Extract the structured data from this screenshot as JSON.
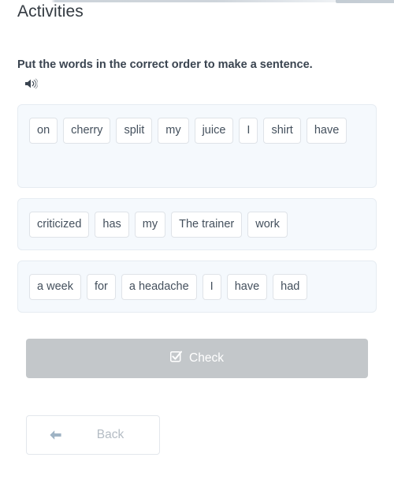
{
  "header": {
    "title": "Activities"
  },
  "instruction": {
    "text": "Put the words in the correct order to make a sentence.",
    "audio_icon": "speaker-icon"
  },
  "exercises": [
    {
      "id": "sentence-1",
      "words": [
        "on",
        "cherry",
        "split",
        "my",
        "juice",
        "I",
        "shirt",
        "have"
      ]
    },
    {
      "id": "sentence-2",
      "words": [
        "criticized",
        "has",
        "my",
        "The trainer",
        "work"
      ]
    },
    {
      "id": "sentence-3",
      "words": [
        "a week",
        "for",
        "a headache",
        "I",
        "have",
        "had"
      ]
    }
  ],
  "actions": {
    "check_label": "Check",
    "check_icon": "checkbox-check-icon",
    "check_state": "disabled",
    "back_label": "Back",
    "back_icon": "arrow-left-icon"
  },
  "colors": {
    "panel_background": "#f5f9fd",
    "panel_border": "#e6ecf2",
    "chip_background": "#ffffff",
    "chip_border": "#dfe3e8",
    "chip_text": "#44505d",
    "check_button_background": "#c3c7ca",
    "check_button_text": "#ffffff",
    "back_button_text": "#b4bcc4",
    "back_arrow": "#9fb3c4",
    "title_text": "#333a41",
    "prompt_text": "#3a4450"
  }
}
